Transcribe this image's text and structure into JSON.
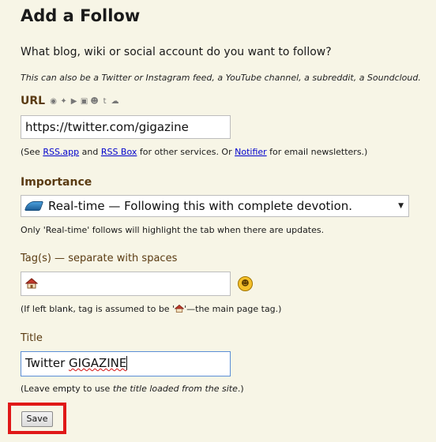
{
  "heading": "Add a Follow",
  "question": "What blog, wiki or social account do you want to follow?",
  "hint": "This can also be a Twitter or Instagram feed, a YouTube channel, a subreddit, a Soundcloud.",
  "url": {
    "label": "URL",
    "value": "https://twitter.com/gigazine",
    "note_prefix": "(See ",
    "link_rssapp": "RSS.app",
    "note_and": " and ",
    "link_rssbox": "RSS Box",
    "note_mid": " for other services. Or ",
    "link_notifier": "Notifier",
    "note_suffix": " for email newsletters.)",
    "service_icons": [
      "rss-icon",
      "twitter-icon",
      "youtube-icon",
      "instagram-icon",
      "reddit-icon",
      "tumblr-icon",
      "soundcloud-icon"
    ]
  },
  "importance": {
    "label": "Importance",
    "selected": "Real-time — Following this with complete devotion.",
    "note": "Only 'Real-time' follows will highlight the tab when there are updates."
  },
  "tags": {
    "label": "Tag(s) — separate with spaces",
    "value_icon": "house-icon",
    "note_prefix": "(If left blank, tag is assumed to be '",
    "note_suffix": "'—the main page tag.)"
  },
  "title": {
    "label": "Title",
    "value_first": "Twitter ",
    "value_second": "GIGAZINE",
    "note_prefix": "(Leave empty to use ",
    "note_italic": "the title loaded from the site",
    "note_suffix": ".)"
  },
  "save_label": "Save",
  "colors": {
    "background": "#f7f5e6",
    "label_brown": "#5a3b12",
    "link_blue": "#0000cc",
    "highlight_red": "#e01818"
  }
}
